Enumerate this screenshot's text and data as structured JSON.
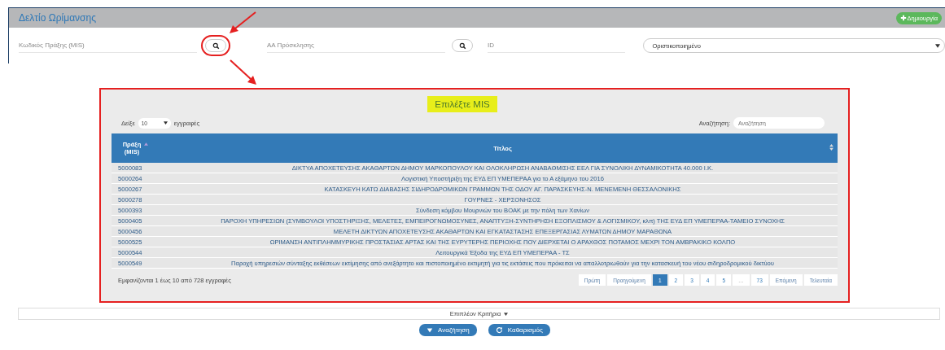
{
  "header": {
    "title": "Δελτίο Ωρίμανσης",
    "create_button": "Δημιουργία"
  },
  "filters": {
    "code": {
      "placeholder": "Κωδικός Πράξης (MIS)"
    },
    "call": {
      "placeholder": "ΑΑ Πρόσκλησης"
    },
    "id": {
      "placeholder": "ID"
    },
    "status": {
      "value": "Οριστικοποιημένο"
    }
  },
  "modal": {
    "title": "Επιλέξτε MIS",
    "length_prefix": "Δείξε",
    "length_value": "10",
    "length_suffix": "εγγραφές",
    "search_label": "Αναζήτηση:",
    "search_placeholder": "Αναζήτηση",
    "columns": [
      {
        "label": "Πράξη (MIS)"
      },
      {
        "label": "Τίτλος"
      }
    ],
    "rows": [
      {
        "mis": "5000083",
        "title": "ΔΙΚΤΥΑ ΑΠΟΧΕΤΕΥΣΗΣ ΑΚΑΘΑΡΤΩΝ ΔΗΜΟΥ ΜΑΡΚΟΠΟΥΛΟΥ ΚΑΙ ΟΛΟΚΛΗΡΩΣΗ ΑΝΑΒΑΘΜΙΣΗΣ ΕΕΛ ΓΙΑ ΣΥΝΟΛΙΚΗ ΔΥΝΑΜΙΚΟΤΗΤΑ 40.000 Ι.Κ."
      },
      {
        "mis": "5000264",
        "title": "Λογιστική Υποστήριξη της ΕΥΔ ΕΠ ΥΜΕΠΕΡΑΑ για το Α εξάμηνο του 2016"
      },
      {
        "mis": "5000267",
        "title": "ΚΑΤΑΣΚΕΥΗ ΚΑΤΩ ΔΙΑΒΑΣΗΣ ΣΙΔΗΡΟΔΡΟΜΙΚΩΝ ΓΡΑΜΜΩΝ ΤΗΣ ΟΔΟΥ ΑΓ. ΠΑΡΑΣΚΕΥΗΣ-Ν. ΜΕΝΕΜΕΝΗ ΘΕΣΣΑΛΟΝΙΚΗΣ"
      },
      {
        "mis": "5000278",
        "title": "ΓΟΥΡΝΕΣ - ΧΕΡΣΟΝΗΣΟΣ"
      },
      {
        "mis": "5000393",
        "title": "Σύνδεση κόμβου Μουρνιών του ΒΟΑΚ με την πόλη των Χανίων"
      },
      {
        "mis": "5000405",
        "title": "ΠΑΡΟΧΗ ΥΠΗΡΕΣΙΩΝ (ΣΥΜΒΟΥΛΟΙ ΥΠΟΣΤΗΡΙΞΗΣ, ΜΕΛΕΤΕΣ, ΕΜΠΕΙΡΟΓΝΩΜΟΣΥΝΕΣ, ΑΝΑΠΤΥΞΗ-ΣΥΝΤΗΡΗΣΗ ΕΞΟΠΛΙΣΜΟΥ & ΛΟΓΙΣΜΙΚΟΥ, κλπ) ΤΗΣ ΕΥΔ ΕΠ ΥΜΕΠΕΡΑΑ-ΤΑΜΕΙΟ ΣΥΝΟΧΗΣ"
      },
      {
        "mis": "5000456",
        "title": "ΜΕΛΕΤΗ ΔΙΚΤΥΩΝ ΑΠΟΧΕΤΕΥΣΗΣ ΑΚΑΘΑΡΤΩΝ ΚΑΙ ΕΓΚΑΤΑΣΤΑΣΗΣ ΕΠΕΞΕΡΓΑΣΙΑΣ ΛΥΜΑΤΩΝ ΔΗΜΟΥ ΜΑΡΑΘΩΝΑ"
      },
      {
        "mis": "5000525",
        "title": "ΩΡΙΜΑΝΣΗ ΑΝΤΙΠΛΗΜΜΥΡΙΚΗΣ ΠΡΟΣΤΑΣΙΑΣ ΑΡΤΑΣ ΚΑΙ ΤΗΣ ΕΥΡΥΤΕΡΗΣ ΠΕΡΙΟΧΗΣ ΠΟΥ ΔΙΕΡΧΕΤΑΙ Ο ΑΡΑΧΘΟΣ ΠΟΤΑΜΟΣ ΜΕΧΡΙ ΤΟΝ ΑΜΒΡΑΚΙΚΟ ΚΟΛΠΟ"
      },
      {
        "mis": "5000544",
        "title": "Λειτουργικά Έξοδα της ΕΥΔ ΕΠ ΥΜΕΠΕΡΑΑ - ΤΣ"
      },
      {
        "mis": "5000549",
        "title": "Παροχή υπηρεσιών σύνταξης εκθέσεων εκτίμησης από ανεξάρτητο και πιστοποιημένο εκτιμητή για τις εκτάσεις που πρόκειται να απαλλοτριωθούν για την κατασκευή του νέου σιδηροδρομικού δικτύου"
      }
    ],
    "info": "Εμφανίζονται 1 έως 10 από 728 εγγραφές",
    "pagination": [
      {
        "label": "Πρώτη",
        "selected": false,
        "kind": "nav"
      },
      {
        "label": "Προηγούμενη",
        "selected": false,
        "kind": "nav"
      },
      {
        "label": "1",
        "selected": true,
        "kind": "page"
      },
      {
        "label": "2",
        "selected": false,
        "kind": "page"
      },
      {
        "label": "3",
        "selected": false,
        "kind": "page"
      },
      {
        "label": "4",
        "selected": false,
        "kind": "page"
      },
      {
        "label": "5",
        "selected": false,
        "kind": "page"
      },
      {
        "label": "…",
        "selected": false,
        "kind": "ellipsis"
      },
      {
        "label": "73",
        "selected": false,
        "kind": "page"
      },
      {
        "label": "Επόμενη",
        "selected": false,
        "kind": "nav"
      },
      {
        "label": "Τελευταία",
        "selected": false,
        "kind": "nav"
      }
    ]
  },
  "more_criteria": "Επιπλέον Κριτήρια",
  "buttons": [
    {
      "label": "Αναζήτηση"
    },
    {
      "label": "Καθαρισμός"
    }
  ]
}
